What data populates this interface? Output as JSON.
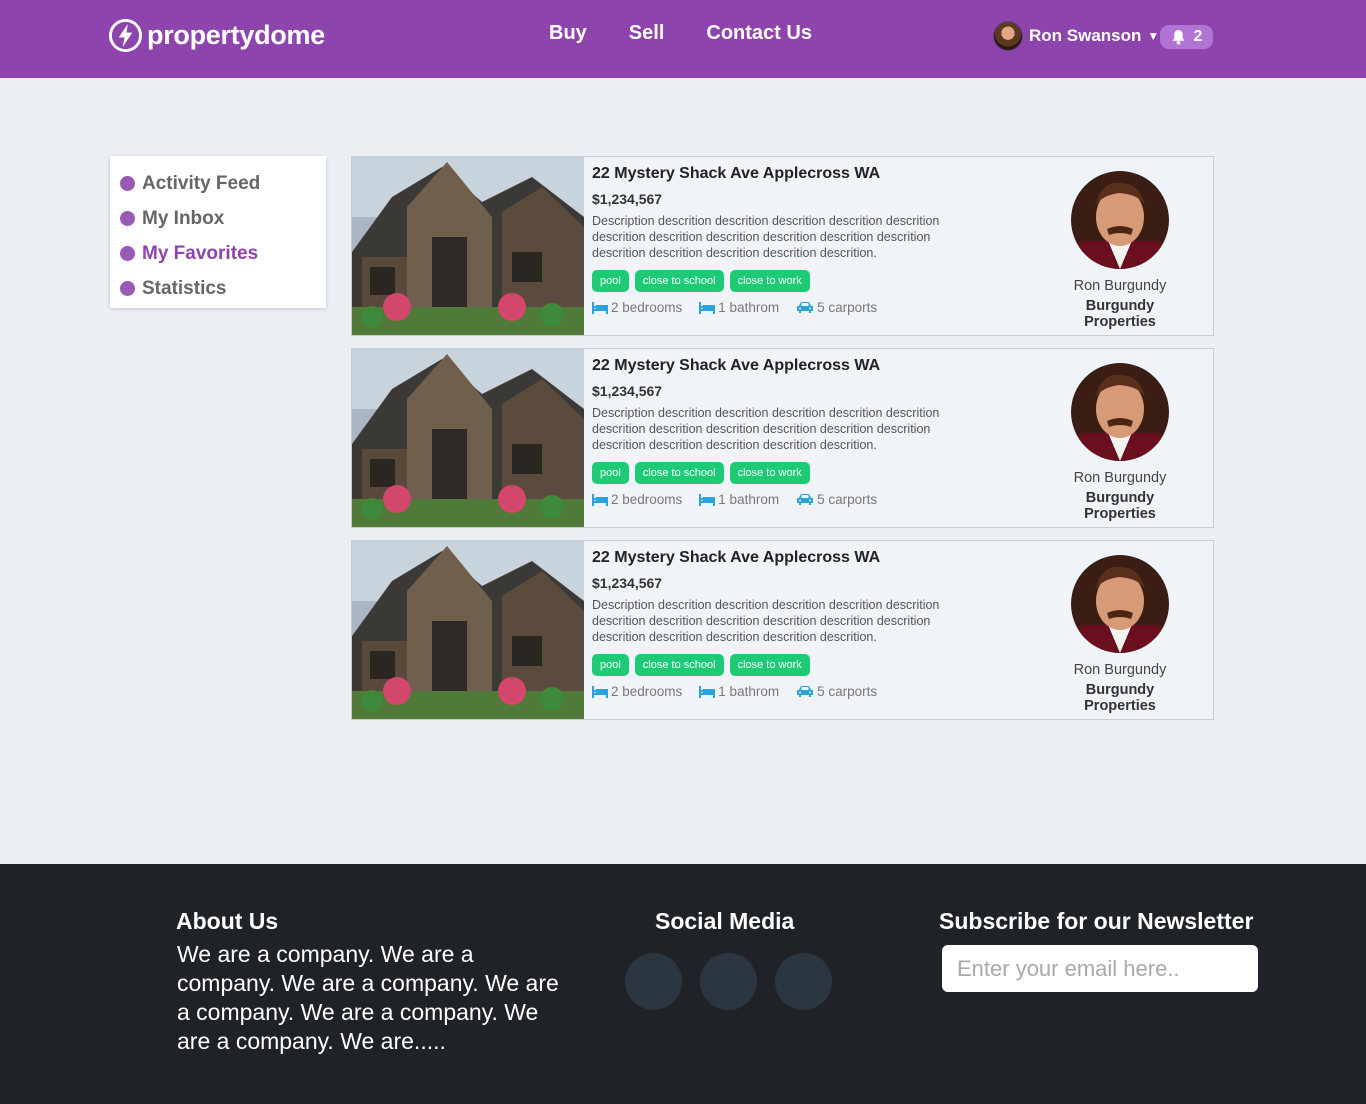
{
  "header": {
    "logo_text": "propertydome",
    "nav": [
      {
        "label": "Buy"
      },
      {
        "label": "Sell"
      },
      {
        "label": "Contact Us"
      }
    ],
    "user_name": "Ron Swanson",
    "notification_count": "2",
    "brand_color": "#8e44ad"
  },
  "sidebar": {
    "items": [
      {
        "label": "Activity Feed"
      },
      {
        "label": "My Inbox"
      },
      {
        "label": "My Favorites",
        "active": true
      },
      {
        "label": "Statistics"
      }
    ]
  },
  "listings": [
    {
      "title": "22 Mystery Shack Ave Applecross WA",
      "price": "$1,234,567",
      "description": "Description descrition descrition descrition descrition descrition descrition descrition descrition descrition descrition descrition descrition descrition descrition descrition descrition.",
      "tags": [
        "pool",
        "close to school",
        "close to work"
      ],
      "bedrooms": "2 bedrooms",
      "bathrooms": "1 bathrom",
      "carports": "5 carports",
      "agent_name": "Ron Burgundy",
      "agent_company": "Burgundy Properties"
    },
    {
      "title": "22 Mystery Shack Ave Applecross WA",
      "price": "$1,234,567",
      "description": "Description descrition descrition descrition descrition descrition descrition descrition descrition descrition descrition descrition descrition descrition descrition descrition descrition.",
      "tags": [
        "pool",
        "close to school",
        "close to work"
      ],
      "bedrooms": "2 bedrooms",
      "bathrooms": "1 bathrom",
      "carports": "5 carports",
      "agent_name": "Ron Burgundy",
      "agent_company": "Burgundy Properties"
    },
    {
      "title": "22 Mystery Shack Ave Applecross WA",
      "price": "$1,234,567",
      "description": "Description descrition descrition descrition descrition descrition descrition descrition descrition descrition descrition descrition descrition descrition descrition descrition descrition.",
      "tags": [
        "pool",
        "close to school",
        "close to work"
      ],
      "bedrooms": "2 bedrooms",
      "bathrooms": "1 bathrom",
      "carports": "5 carports",
      "agent_name": "Ron Burgundy",
      "agent_company": "Burgundy Properties"
    }
  ],
  "footer": {
    "about_heading": "About Us",
    "about_text": "We are a company. We are a company. We are a company. We are a company. We are a company. We are a company. We are.....",
    "social_heading": "Social Media",
    "newsletter_heading": "Subscribe for our Newsletter",
    "email_placeholder": "Enter your email here.."
  }
}
